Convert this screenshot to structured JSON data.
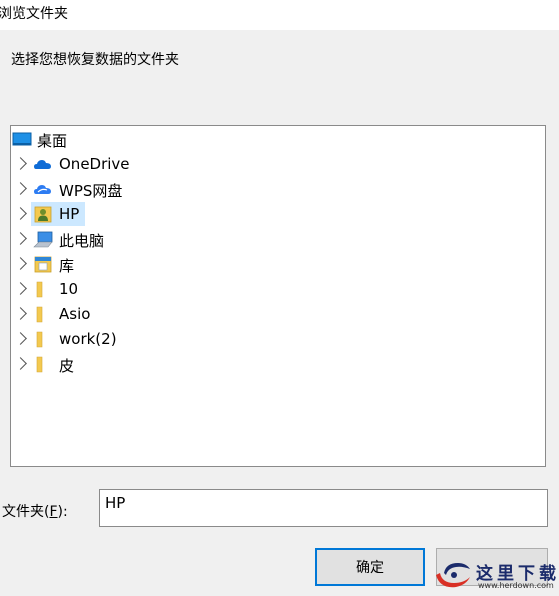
{
  "window": {
    "title": "浏览文件夹"
  },
  "prompt": "选择您想恢复数据的文件夹",
  "tree": {
    "root": {
      "label": "桌面",
      "icon": "desktop-icon"
    },
    "items": [
      {
        "label": "OneDrive",
        "icon": "onedrive-cloud-icon",
        "selected": false
      },
      {
        "label": "WPS网盘",
        "icon": "wps-cloud-icon",
        "selected": false
      },
      {
        "label": "HP",
        "icon": "user-folder-icon",
        "selected": true
      },
      {
        "label": "此电脑",
        "icon": "computer-icon",
        "selected": false
      },
      {
        "label": "库",
        "icon": "library-icon",
        "selected": false
      },
      {
        "label": "10",
        "icon": "folder-icon",
        "selected": false
      },
      {
        "label": "Asio",
        "icon": "folder-icon",
        "selected": false
      },
      {
        "label": "work(2)",
        "icon": "folder-icon",
        "selected": false
      },
      {
        "label": "皮",
        "icon": "folder-icon",
        "selected": false
      }
    ]
  },
  "folder_field": {
    "label": "文件夹(F):",
    "label_prefix": "文件夹(",
    "label_accel": "F",
    "label_suffix": "):",
    "value": "HP"
  },
  "buttons": {
    "ok": "确定",
    "cancel": ""
  },
  "watermark": {
    "text": "这里下载",
    "url": "www.herdown.com"
  },
  "colors": {
    "accent": "#0078d7",
    "selection": "#cce8ff",
    "folder": "#f3c94f"
  }
}
